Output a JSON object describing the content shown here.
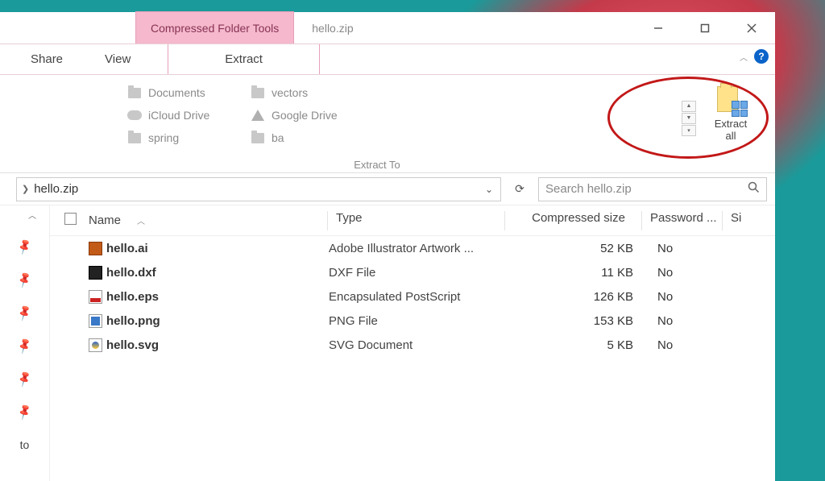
{
  "titlebar": {
    "context_tab": "Compressed Folder Tools",
    "title": "hello.zip"
  },
  "tabs": {
    "share": "Share",
    "view": "View",
    "extract": "Extract"
  },
  "ribbon": {
    "group_label": "Extract To",
    "destinations_col1": [
      {
        "icon": "folder",
        "label": "Documents"
      },
      {
        "icon": "cloud",
        "label": "iCloud Drive"
      },
      {
        "icon": "folder",
        "label": "spring"
      }
    ],
    "destinations_col2": [
      {
        "icon": "folder",
        "label": "vectors"
      },
      {
        "icon": "gdrive",
        "label": "Google Drive"
      },
      {
        "icon": "folder",
        "label": "ba"
      }
    ],
    "extract_all": {
      "label_line1": "Extract",
      "label_line2": "all"
    }
  },
  "address": {
    "path": "hello.zip",
    "search_placeholder": "Search hello.zip"
  },
  "columns": {
    "name": "Name",
    "type": "Type",
    "compressed_size": "Compressed size",
    "password": "Password ...",
    "size_abbrev": "Si"
  },
  "files": [
    {
      "icon": "ai",
      "name": "hello.ai",
      "type": "Adobe Illustrator Artwork ...",
      "csize": "52 KB",
      "pw": "No"
    },
    {
      "icon": "dxf",
      "name": "hello.dxf",
      "type": "DXF File",
      "csize": "11 KB",
      "pw": "No"
    },
    {
      "icon": "eps",
      "name": "hello.eps",
      "type": "Encapsulated PostScript",
      "csize": "126 KB",
      "pw": "No"
    },
    {
      "icon": "png",
      "name": "hello.png",
      "type": "PNG File",
      "csize": "153 KB",
      "pw": "No"
    },
    {
      "icon": "svg",
      "name": "hello.svg",
      "type": "SVG Document",
      "csize": "5 KB",
      "pw": "No"
    }
  ],
  "quick_access_label": "to"
}
